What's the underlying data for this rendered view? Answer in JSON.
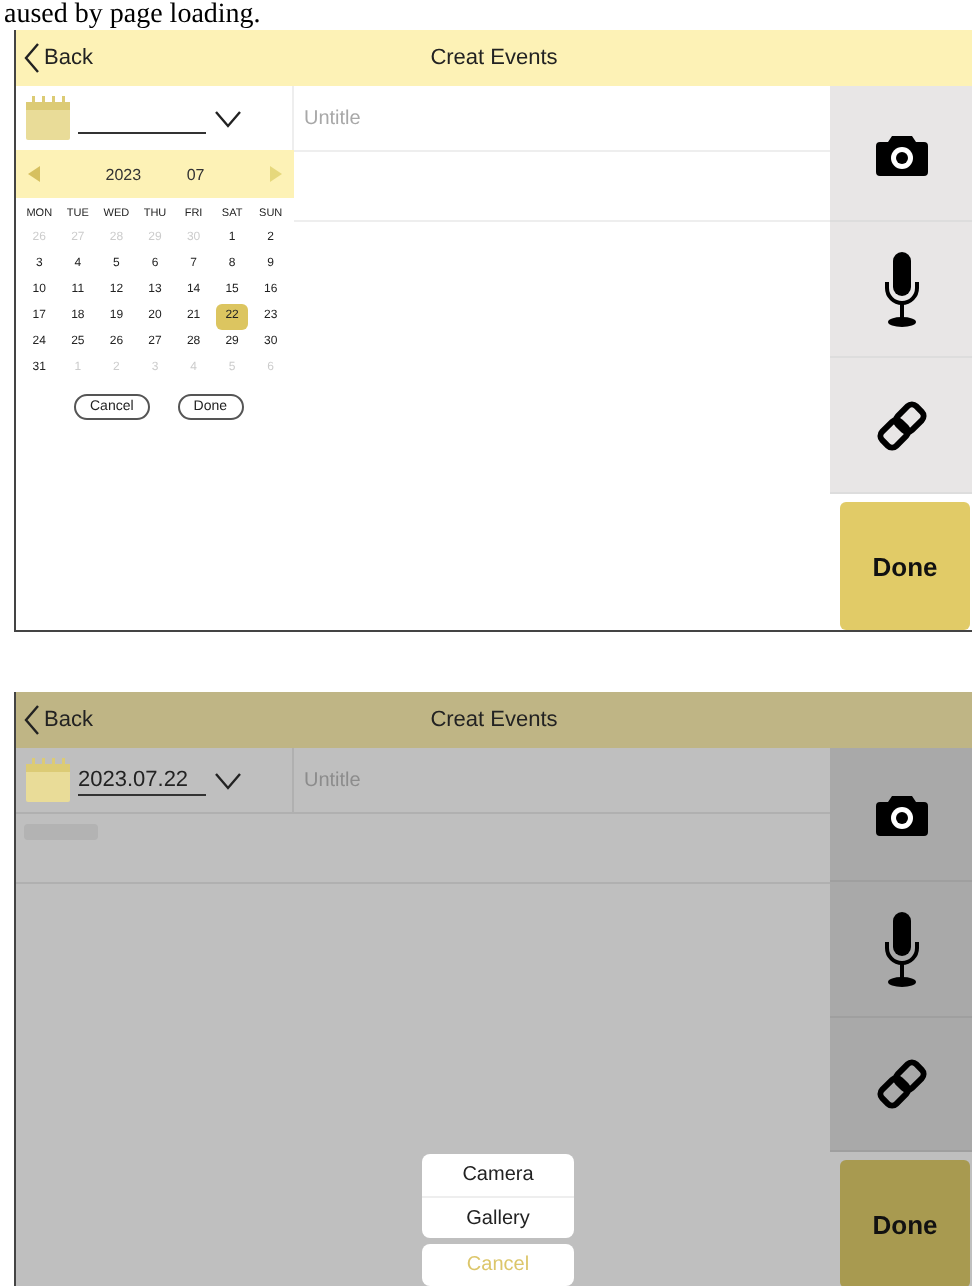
{
  "caption": "aused by page loading.",
  "screens": [
    {
      "back": "Back",
      "title": "Creat Events",
      "dimmed": false,
      "title_placeholder": "Untitle",
      "done": "Done",
      "date_picker": {
        "year": "2023",
        "month": "07",
        "weekdays": [
          "MON",
          "TUE",
          "WED",
          "THU",
          "FRI",
          "SAT",
          "SUN"
        ],
        "days": [
          {
            "label": "26",
            "muted": true,
            "selected": false
          },
          {
            "label": "27",
            "muted": true,
            "selected": false
          },
          {
            "label": "28",
            "muted": true,
            "selected": false
          },
          {
            "label": "29",
            "muted": true,
            "selected": false
          },
          {
            "label": "30",
            "muted": true,
            "selected": false
          },
          {
            "label": "1",
            "muted": false,
            "selected": false
          },
          {
            "label": "2",
            "muted": false,
            "selected": false
          },
          {
            "label": "3",
            "muted": false,
            "selected": false
          },
          {
            "label": "4",
            "muted": false,
            "selected": false
          },
          {
            "label": "5",
            "muted": false,
            "selected": false
          },
          {
            "label": "6",
            "muted": false,
            "selected": false
          },
          {
            "label": "7",
            "muted": false,
            "selected": false
          },
          {
            "label": "8",
            "muted": false,
            "selected": false
          },
          {
            "label": "9",
            "muted": false,
            "selected": false
          },
          {
            "label": "10",
            "muted": false,
            "selected": false
          },
          {
            "label": "11",
            "muted": false,
            "selected": false
          },
          {
            "label": "12",
            "muted": false,
            "selected": false
          },
          {
            "label": "13",
            "muted": false,
            "selected": false
          },
          {
            "label": "14",
            "muted": false,
            "selected": false
          },
          {
            "label": "15",
            "muted": false,
            "selected": false
          },
          {
            "label": "16",
            "muted": false,
            "selected": false
          },
          {
            "label": "17",
            "muted": false,
            "selected": false
          },
          {
            "label": "18",
            "muted": false,
            "selected": false
          },
          {
            "label": "19",
            "muted": false,
            "selected": false
          },
          {
            "label": "20",
            "muted": false,
            "selected": false
          },
          {
            "label": "21",
            "muted": false,
            "selected": false
          },
          {
            "label": "22",
            "muted": false,
            "selected": true
          },
          {
            "label": "23",
            "muted": false,
            "selected": false
          },
          {
            "label": "24",
            "muted": false,
            "selected": false
          },
          {
            "label": "25",
            "muted": false,
            "selected": false
          },
          {
            "label": "26",
            "muted": false,
            "selected": false
          },
          {
            "label": "27",
            "muted": false,
            "selected": false
          },
          {
            "label": "28",
            "muted": false,
            "selected": false
          },
          {
            "label": "29",
            "muted": false,
            "selected": false
          },
          {
            "label": "30",
            "muted": false,
            "selected": false
          },
          {
            "label": "31",
            "muted": false,
            "selected": false
          },
          {
            "label": "1",
            "muted": true,
            "selected": false
          },
          {
            "label": "2",
            "muted": true,
            "selected": false
          },
          {
            "label": "3",
            "muted": true,
            "selected": false
          },
          {
            "label": "4",
            "muted": true,
            "selected": false
          },
          {
            "label": "5",
            "muted": true,
            "selected": false
          },
          {
            "label": "6",
            "muted": true,
            "selected": false
          }
        ],
        "buttons": [
          "Cancel",
          "Done"
        ]
      }
    },
    {
      "back": "Back",
      "title": "Creat Events",
      "dimmed": true,
      "date_value": "2023.07.22",
      "title_placeholder": "Untitle",
      "show_tag_chip": true,
      "done": "Done",
      "action_sheet": {
        "options": [
          "Camera",
          "Gallery"
        ],
        "cancel": "Cancel"
      }
    }
  ]
}
